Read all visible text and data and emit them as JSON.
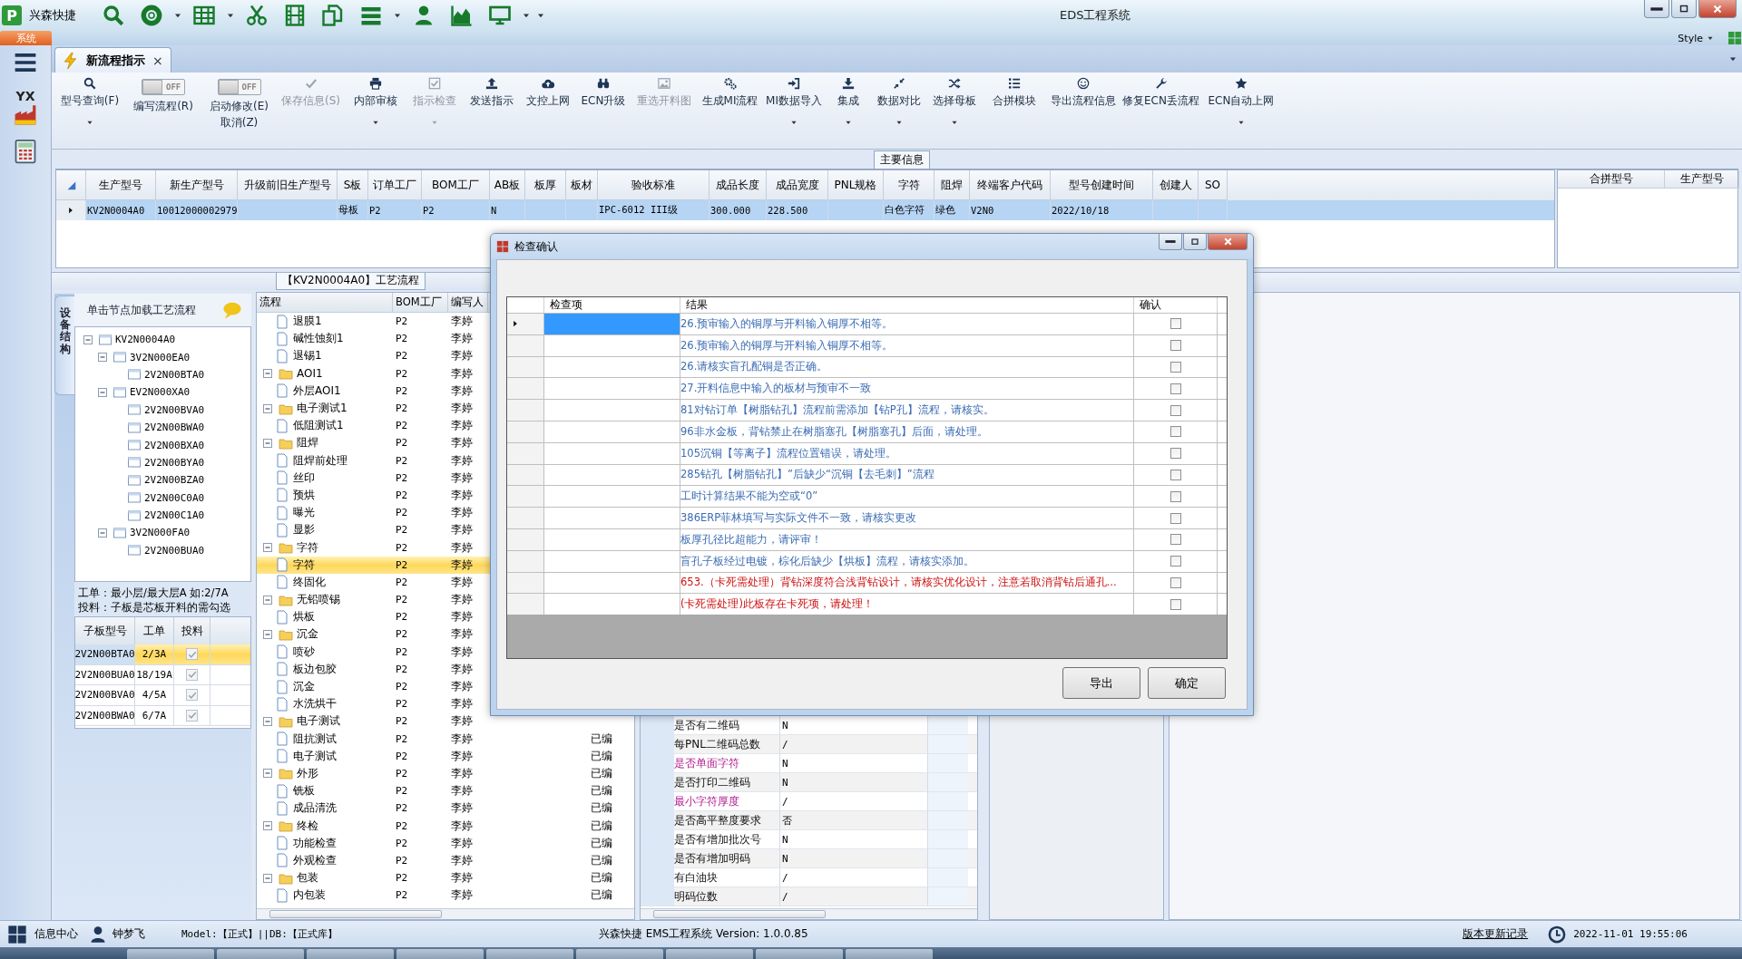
{
  "window": {
    "logo": "P",
    "app_name": "兴森快捷",
    "title": "EDS工程系统",
    "style_label": "Style"
  },
  "system_tab": {
    "label": "系统"
  },
  "nav": {
    "app_badge": "YX"
  },
  "doc_tab": {
    "label": "新流程指示",
    "close": "×",
    "selected": true
  },
  "ribbon": [
    {
      "kind": "button",
      "label": "型号查询(F)",
      "disabled": false,
      "dropdown": true
    },
    {
      "kind": "toggle",
      "label": "编写流程(R)",
      "switch_text": "OFF",
      "on": false
    },
    {
      "kind": "toggle",
      "label": "启动修改(E)",
      "sub_label": "取消(Z)",
      "switch_text": "OFF",
      "on": false
    },
    {
      "kind": "button",
      "label": "保存信息(S)",
      "disabled": true,
      "dropdown": false
    },
    {
      "kind": "button",
      "label": "内部审核",
      "disabled": false,
      "dropdown": true
    },
    {
      "kind": "button",
      "label": "指示检查",
      "disabled": true,
      "dropdown": true
    },
    {
      "kind": "button",
      "label": "发送指示",
      "disabled": false,
      "dropdown": false
    },
    {
      "kind": "button",
      "label": "文控上网",
      "disabled": false,
      "dropdown": false
    },
    {
      "kind": "button",
      "label": "ECN升级",
      "disabled": false,
      "dropdown": false
    },
    {
      "kind": "button",
      "label": "重选开料图",
      "disabled": true,
      "dropdown": false
    },
    {
      "kind": "button",
      "label": "生成MI流程",
      "disabled": false,
      "dropdown": false
    },
    {
      "kind": "button",
      "label": "MI数据导入",
      "disabled": false,
      "dropdown": true
    },
    {
      "kind": "button",
      "label": "集成",
      "disabled": false,
      "dropdown": true
    },
    {
      "kind": "button",
      "label": "数据对比",
      "disabled": false,
      "dropdown": true
    },
    {
      "kind": "button",
      "label": "选择母板",
      "disabled": false,
      "dropdown": true
    },
    {
      "kind": "button",
      "label": "合拼模块",
      "disabled": false,
      "dropdown": false
    },
    {
      "kind": "button",
      "label": "导出流程信息",
      "disabled": false,
      "dropdown": false
    },
    {
      "kind": "button",
      "label": "修复ECN丢流程",
      "disabled": false,
      "dropdown": false
    },
    {
      "kind": "button",
      "label": "ECN自动上网",
      "disabled": false,
      "dropdown": true
    }
  ],
  "main_info": {
    "caption": "主要信息",
    "columns": [
      "生产型号",
      "新生产型号",
      "升级前旧生产型号",
      "S板",
      "订单工厂",
      "BOM工厂",
      "AB板",
      "板厚",
      "板材",
      "验收标准",
      "成品长度",
      "成品宽度",
      "PNL规格",
      "字符",
      "阻焊",
      "终端客户代码",
      "型号创建时间",
      "创建人",
      "SO"
    ],
    "rows": [
      {
        "selected": true,
        "cells": [
          {
            "text": "KV2N0004A0"
          },
          {
            "text": "10012000002979"
          },
          {},
          {
            "text": "母板"
          },
          {
            "text": "P2"
          },
          {
            "text": "P2"
          },
          {
            "text": "N"
          },
          {},
          {},
          {
            "text": "IPC-6012 III级"
          },
          {
            "text": "300.000"
          },
          {
            "text": "228.500"
          },
          {},
          {
            "text": "白色字符"
          },
          {
            "text": "绿色"
          },
          {
            "text": "V2N0"
          },
          {
            "text": "2022/10/18"
          },
          {},
          {}
        ]
      }
    ],
    "merge_columns": [
      "合拼型号",
      "生产型号"
    ]
  },
  "process": {
    "caption": "【KV2N0004A0】工艺流程",
    "side_tab": "设备结构",
    "tree_hint": "单击节点加载工艺流程",
    "tree": [
      {
        "label": "KV2N0004A0",
        "expanded": true,
        "children": [
          {
            "label": "3V2N000EA0",
            "expanded": true,
            "children": [
              {
                "label": "2V2N00BTA0"
              }
            ]
          },
          {
            "label": "EV2N000XA0",
            "expanded": true,
            "children": [
              {
                "label": "2V2N00BVA0"
              },
              {
                "label": "2V2N00BWA0"
              },
              {
                "label": "2V2N00BXA0"
              },
              {
                "label": "2V2N00BYA0"
              },
              {
                "label": "2V2N00BZA0"
              },
              {
                "label": "2V2N00C0A0"
              },
              {
                "label": "2V2N00C1A0"
              }
            ]
          },
          {
            "label": "3V2N000FA0",
            "expanded": true,
            "children": [
              {
                "label": "2V2N00BUA0"
              }
            ]
          }
        ]
      }
    ],
    "notes": [
      "工单：最小层/最大层A 如:2/7A",
      "投料：子板是芯板开料的需勾选"
    ],
    "sub_boards": {
      "columns": [
        "子板型号",
        "工单",
        "投料"
      ],
      "rows": [
        {
          "board": "2V2N00BTA0",
          "order": "2/3A",
          "checked": true,
          "selected": true
        },
        {
          "board": "2V2N00BUA0",
          "order": "18/19A",
          "checked": true,
          "selected": false
        },
        {
          "board": "2V2N00BVA0",
          "order": "4/5A",
          "checked": true,
          "selected": false
        },
        {
          "board": "2V2N00BWA0",
          "order": "6/7A",
          "checked": true,
          "selected": false
        }
      ]
    },
    "flow": {
      "columns": [
        "流程",
        "BOM工厂",
        "编写人"
      ],
      "rows": [
        {
          "expanded": true,
          "children": [
            {
              "label": "退膜1",
              "bom": "P2",
              "writer": "李婷",
              "selected": false
            },
            {
              "label": "碱性蚀刻1",
              "bom": "P2",
              "writer": "李婷",
              "selected": false
            },
            {
              "label": "退锡1",
              "bom": "P2",
              "writer": "李婷",
              "selected": false
            }
          ]
        },
        {
          "label": "AOI1",
          "bom": "P2",
          "writer": "李婷",
          "selected": false,
          "expanded": true,
          "children": [
            {
              "label": "外层AOI1",
              "bom": "P2",
              "writer": "李婷",
              "selected": false
            }
          ]
        },
        {
          "label": "电子测试1",
          "bom": "P2",
          "writer": "李婷",
          "selected": false,
          "expanded": true,
          "children": [
            {
              "label": "低阻测试1",
              "bom": "P2",
              "writer": "李婷",
              "selected": false
            }
          ]
        },
        {
          "label": "阻焊",
          "bom": "P2",
          "writer": "李婷",
          "selected": false,
          "expanded": true,
          "children": [
            {
              "label": "阻焊前处理",
              "bom": "P2",
              "writer": "李婷",
              "selected": false
            },
            {
              "label": "丝印",
              "bom": "P2",
              "writer": "李婷",
              "selected": false
            },
            {
              "label": "预烘",
              "bom": "P2",
              "writer": "李婷",
              "selected": false
            },
            {
              "label": "曝光",
              "bom": "P2",
              "writer": "李婷",
              "selected": false
            },
            {
              "label": "显影",
              "bom": "P2",
              "writer": "李婷",
              "selected": false
            }
          ]
        },
        {
          "label": "字符",
          "bom": "P2",
          "writer": "李婷",
          "selected": false,
          "expanded": true,
          "children": [
            {
              "label": "字符",
              "bom": "P2",
              "writer": "李婷",
              "selected": true
            },
            {
              "label": "终固化",
              "bom": "P2",
              "writer": "李婷",
              "selected": false
            }
          ]
        },
        {
          "label": "无铅喷锡",
          "bom": "P2",
          "writer": "李婷",
          "selected": false,
          "expanded": true,
          "children": [
            {
              "label": "烘板",
              "bom": "P2",
              "writer": "李婷",
              "selected": false
            }
          ]
        },
        {
          "label": "沉金",
          "bom": "P2",
          "writer": "李婷",
          "selected": false,
          "expanded": true,
          "children": [
            {
              "label": "喷砂",
              "bom": "P2",
              "writer": "李婷",
              "selected": false
            },
            {
              "label": "板边包胶",
              "bom": "P2",
              "writer": "李婷",
              "selected": false
            },
            {
              "label": "沉金",
              "bom": "P2",
              "writer": "李婷",
              "selected": false
            },
            {
              "label": "水洗烘干",
              "bom": "P2",
              "writer": "李婷",
              "selected": false
            }
          ]
        },
        {
          "label": "电子测试",
          "bom": "P2",
          "writer": "李婷",
          "selected": false,
          "expanded": true,
          "children": [
            {
              "label": "阻抗测试",
              "bom": "P2",
              "writer": "李婷",
              "status": "已编",
              "selected": false
            },
            {
              "label": "电子测试",
              "bom": "P2",
              "writer": "李婷",
              "status": "已编",
              "selected": false
            }
          ]
        },
        {
          "label": "外形",
          "bom": "P2",
          "writer": "李婷",
          "status": "已编",
          "selected": false,
          "expanded": true,
          "children": [
            {
              "label": "铣板",
              "bom": "P2",
              "writer": "李婷",
              "status": "已编",
              "selected": false
            },
            {
              "label": "成品清洗",
              "bom": "P2",
              "writer": "李婷",
              "status": "已编",
              "selected": false
            }
          ]
        },
        {
          "label": "终检",
          "bom": "P2",
          "writer": "李婷",
          "status": "已编",
          "selected": false,
          "expanded": true,
          "children": [
            {
              "label": "功能检查",
              "bom": "P2",
              "writer": "李婷",
              "status": "已编",
              "selected": false
            },
            {
              "label": "外观检查",
              "bom": "P2",
              "writer": "李婷",
              "status": "已编",
              "selected": false
            }
          ]
        },
        {
          "label": "包装",
          "bom": "P2",
          "writer": "李婷",
          "status": "已编",
          "selected": false,
          "expanded": true,
          "children": [
            {
              "label": "内包装",
              "bom": "P2",
              "writer": "李婷",
              "status": "已编",
              "selected": false
            }
          ]
        }
      ]
    },
    "properties": {
      "rows": [
        {
          "name": "是否有二维码",
          "value": "N",
          "highlighted": false
        },
        {
          "name": "每PNL二维码总数",
          "value": "/",
          "highlighted": false
        },
        {
          "name": "是否单面字符",
          "value": "N",
          "highlighted": true
        },
        {
          "name": "是否打印二维码",
          "value": "N",
          "highlighted": false
        },
        {
          "name": "最小字符厚度",
          "value": "/",
          "highlighted": true
        },
        {
          "name": "是否高平整度要求",
          "value": "否",
          "highlighted": false
        },
        {
          "name": "是否有增加批次号",
          "value": "N",
          "highlighted": false
        },
        {
          "name": "是否有增加明码",
          "value": "N",
          "highlighted": false
        },
        {
          "name": "有白油块",
          "value": "/",
          "highlighted": false
        },
        {
          "name": "明码位数",
          "value": "/",
          "highlighted": false
        }
      ]
    }
  },
  "dialog": {
    "title": "检查确认",
    "columns": [
      "检查项",
      "结果",
      "确认"
    ],
    "rows": [
      {
        "result": "26.预审输入的铜厚与开料输入铜厚不相等。",
        "color": "#3d6db3",
        "checked": false,
        "selected": true
      },
      {
        "result": "26.预审输入的铜厚与开料输入铜厚不相等。",
        "color": "#3d6db3",
        "checked": false,
        "selected": false
      },
      {
        "result": "26.请核实盲孔配铜是否正确。",
        "color": "#3d6db3",
        "checked": false,
        "selected": false
      },
      {
        "result": "27.开料信息中输入的板材与预审不一致",
        "color": "#3d6db3",
        "checked": false,
        "selected": false
      },
      {
        "result": "81对钻订单【树脂钻孔】流程前需添加【钻P孔】流程，请核实。",
        "color": "#3d6db3",
        "checked": false,
        "selected": false
      },
      {
        "result": "96非水金板，背钻禁止在树脂塞孔【树脂塞孔】后面，请处理。",
        "color": "#3d6db3",
        "checked": false,
        "selected": false
      },
      {
        "result": "105沉铜【等离子】流程位置错误，请处理。",
        "color": "#3d6db3",
        "checked": false,
        "selected": false
      },
      {
        "result": "285钻孔【树脂钻孔】”后缺少“沉铜【去毛刺】”流程",
        "color": "#3d6db3",
        "checked": false,
        "selected": false
      },
      {
        "result": "工时计算结果不能为空或“0”",
        "color": "#3d6db3",
        "checked": false,
        "selected": false
      },
      {
        "result": "386ERP菲林填写与实际文件不一致，请核实更改",
        "color": "#3d6db3",
        "checked": false,
        "selected": false
      },
      {
        "result": "板厚孔径比超能力，请评审！",
        "color": "#3d6db3",
        "checked": false,
        "selected": false
      },
      {
        "result": "盲孔子板经过电镀，棕化后缺少【烘板】流程，请核实添加。",
        "color": "#3d6db3",
        "checked": false,
        "selected": false
      },
      {
        "result": "653.（卡死需处理）背钻深度符合浅背钻设计，请核实优化设计，注意若取消背钻后通孔...",
        "color": "#cc1111",
        "checked": false,
        "selected": false
      },
      {
        "result": "(卡死需处理)此板存在卡死项，请处理！",
        "color": "#cc1111",
        "checked": false,
        "selected": false
      }
    ],
    "buttons": [
      "导出",
      "确定"
    ]
  },
  "status_bar": {
    "info": "信息中心",
    "user": "钟梦飞",
    "model": "Model:【正式】||DB:【正式库】",
    "version": "兴森快捷 EMS工程系统 Version: 1.0.0.85",
    "changelog": "版本更新记录",
    "datetime": "2022-11-01 19:55:06"
  }
}
